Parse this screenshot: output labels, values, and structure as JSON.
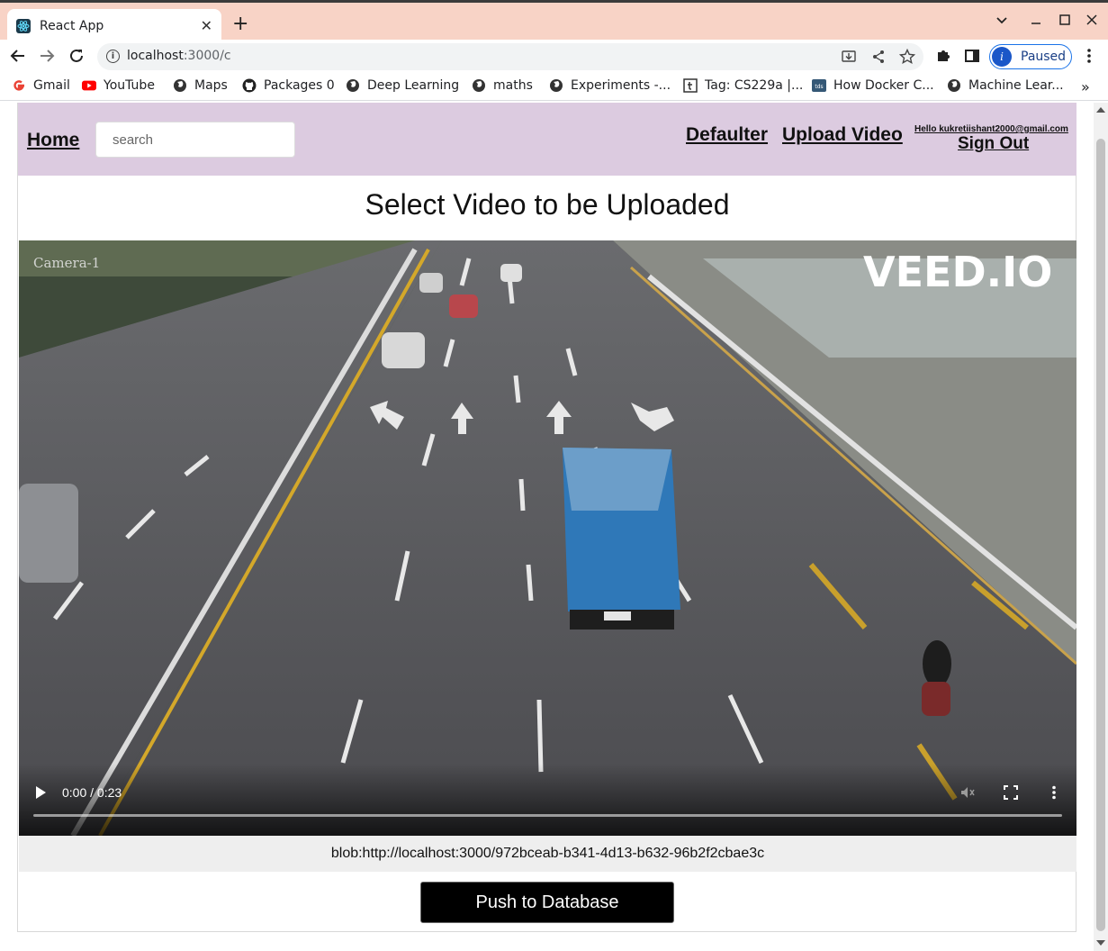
{
  "browser": {
    "tab": {
      "title": "React App",
      "close": "✕"
    },
    "new_tab": "+",
    "url": {
      "host": "localhost",
      "path": ":3000/c"
    },
    "profile_label": "Paused",
    "profile_initial": "i",
    "bookmarks": [
      {
        "label": "Gmail",
        "icon": "google-icon"
      },
      {
        "label": "YouTube",
        "icon": "youtube-icon"
      },
      {
        "label": "Maps",
        "icon": "globe-icon"
      },
      {
        "label": "Packages 0",
        "icon": "github-icon"
      },
      {
        "label": "Deep Learning",
        "icon": "globe-icon"
      },
      {
        "label": "maths",
        "icon": "globe-icon"
      },
      {
        "label": "Experiments -...",
        "icon": "globe-icon"
      },
      {
        "label": "Tag: CS229a |...",
        "icon": "tumblr-icon"
      },
      {
        "label": "How Docker C...",
        "icon": "tds-icon"
      },
      {
        "label": "Machine Lear...",
        "icon": "globe-icon"
      }
    ],
    "bookmarks_more": "»"
  },
  "navbar": {
    "home": "Home",
    "search_placeholder": "search",
    "defaulter": "Defaulter",
    "upload_video": "Upload Video",
    "hello": "Hello kukretiishant2000@gmail.com",
    "sign_out": "Sign Out"
  },
  "page": {
    "heading": "Select Video to be Uploaded",
    "blob_url": "blob:http://localhost:3000/972bceab-b341-4d13-b632-96b2f2cbae3c",
    "push_button": "Push to Database"
  },
  "video": {
    "time": "0:00 / 0:23",
    "progress": 0,
    "watermark": "VEED.IO",
    "camera_label": "Camera-1"
  },
  "colors": {
    "tabstrip": "#f8d3c6",
    "navbar": "#dccbe0",
    "profile_accent": "#1a73e8"
  }
}
